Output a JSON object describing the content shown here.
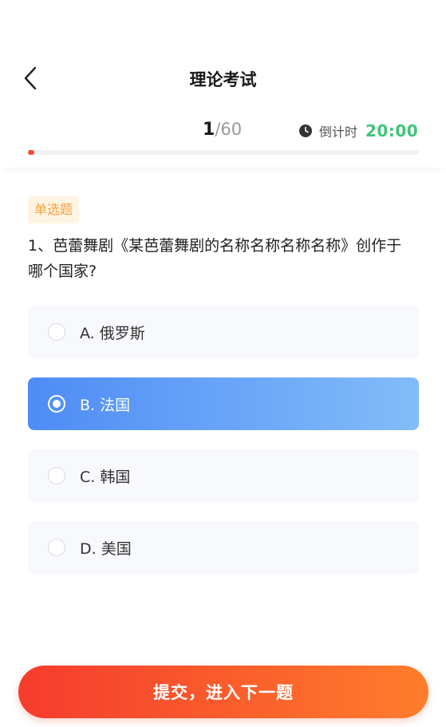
{
  "header": {
    "title": "理论考试",
    "back_icon": "chevron-left-icon"
  },
  "progress": {
    "current": "1",
    "total_text": "/60",
    "fraction": 0.0167,
    "bar_color": "#f24a38"
  },
  "timer": {
    "icon": "clock-icon",
    "label": "倒计时",
    "value": "20:00",
    "color": "#3fc47a"
  },
  "question": {
    "type_tag": "单选题",
    "text": "1、芭蕾舞剧《某芭蕾舞剧的名称名称名称名称》创作于哪个国家?"
  },
  "options": [
    {
      "label": "A. 俄罗斯",
      "selected": false
    },
    {
      "label": "B. 法国",
      "selected": true
    },
    {
      "label": "C. 韩国",
      "selected": false
    },
    {
      "label": "D. 美国",
      "selected": false
    }
  ],
  "submit": {
    "label": "提交，进入下一题"
  },
  "colors": {
    "accent_blue": "#4e8cf6",
    "tag_orange": "#f4a33c",
    "submit_red": "#f53b2d",
    "submit_orange": "#ff7d2c"
  }
}
